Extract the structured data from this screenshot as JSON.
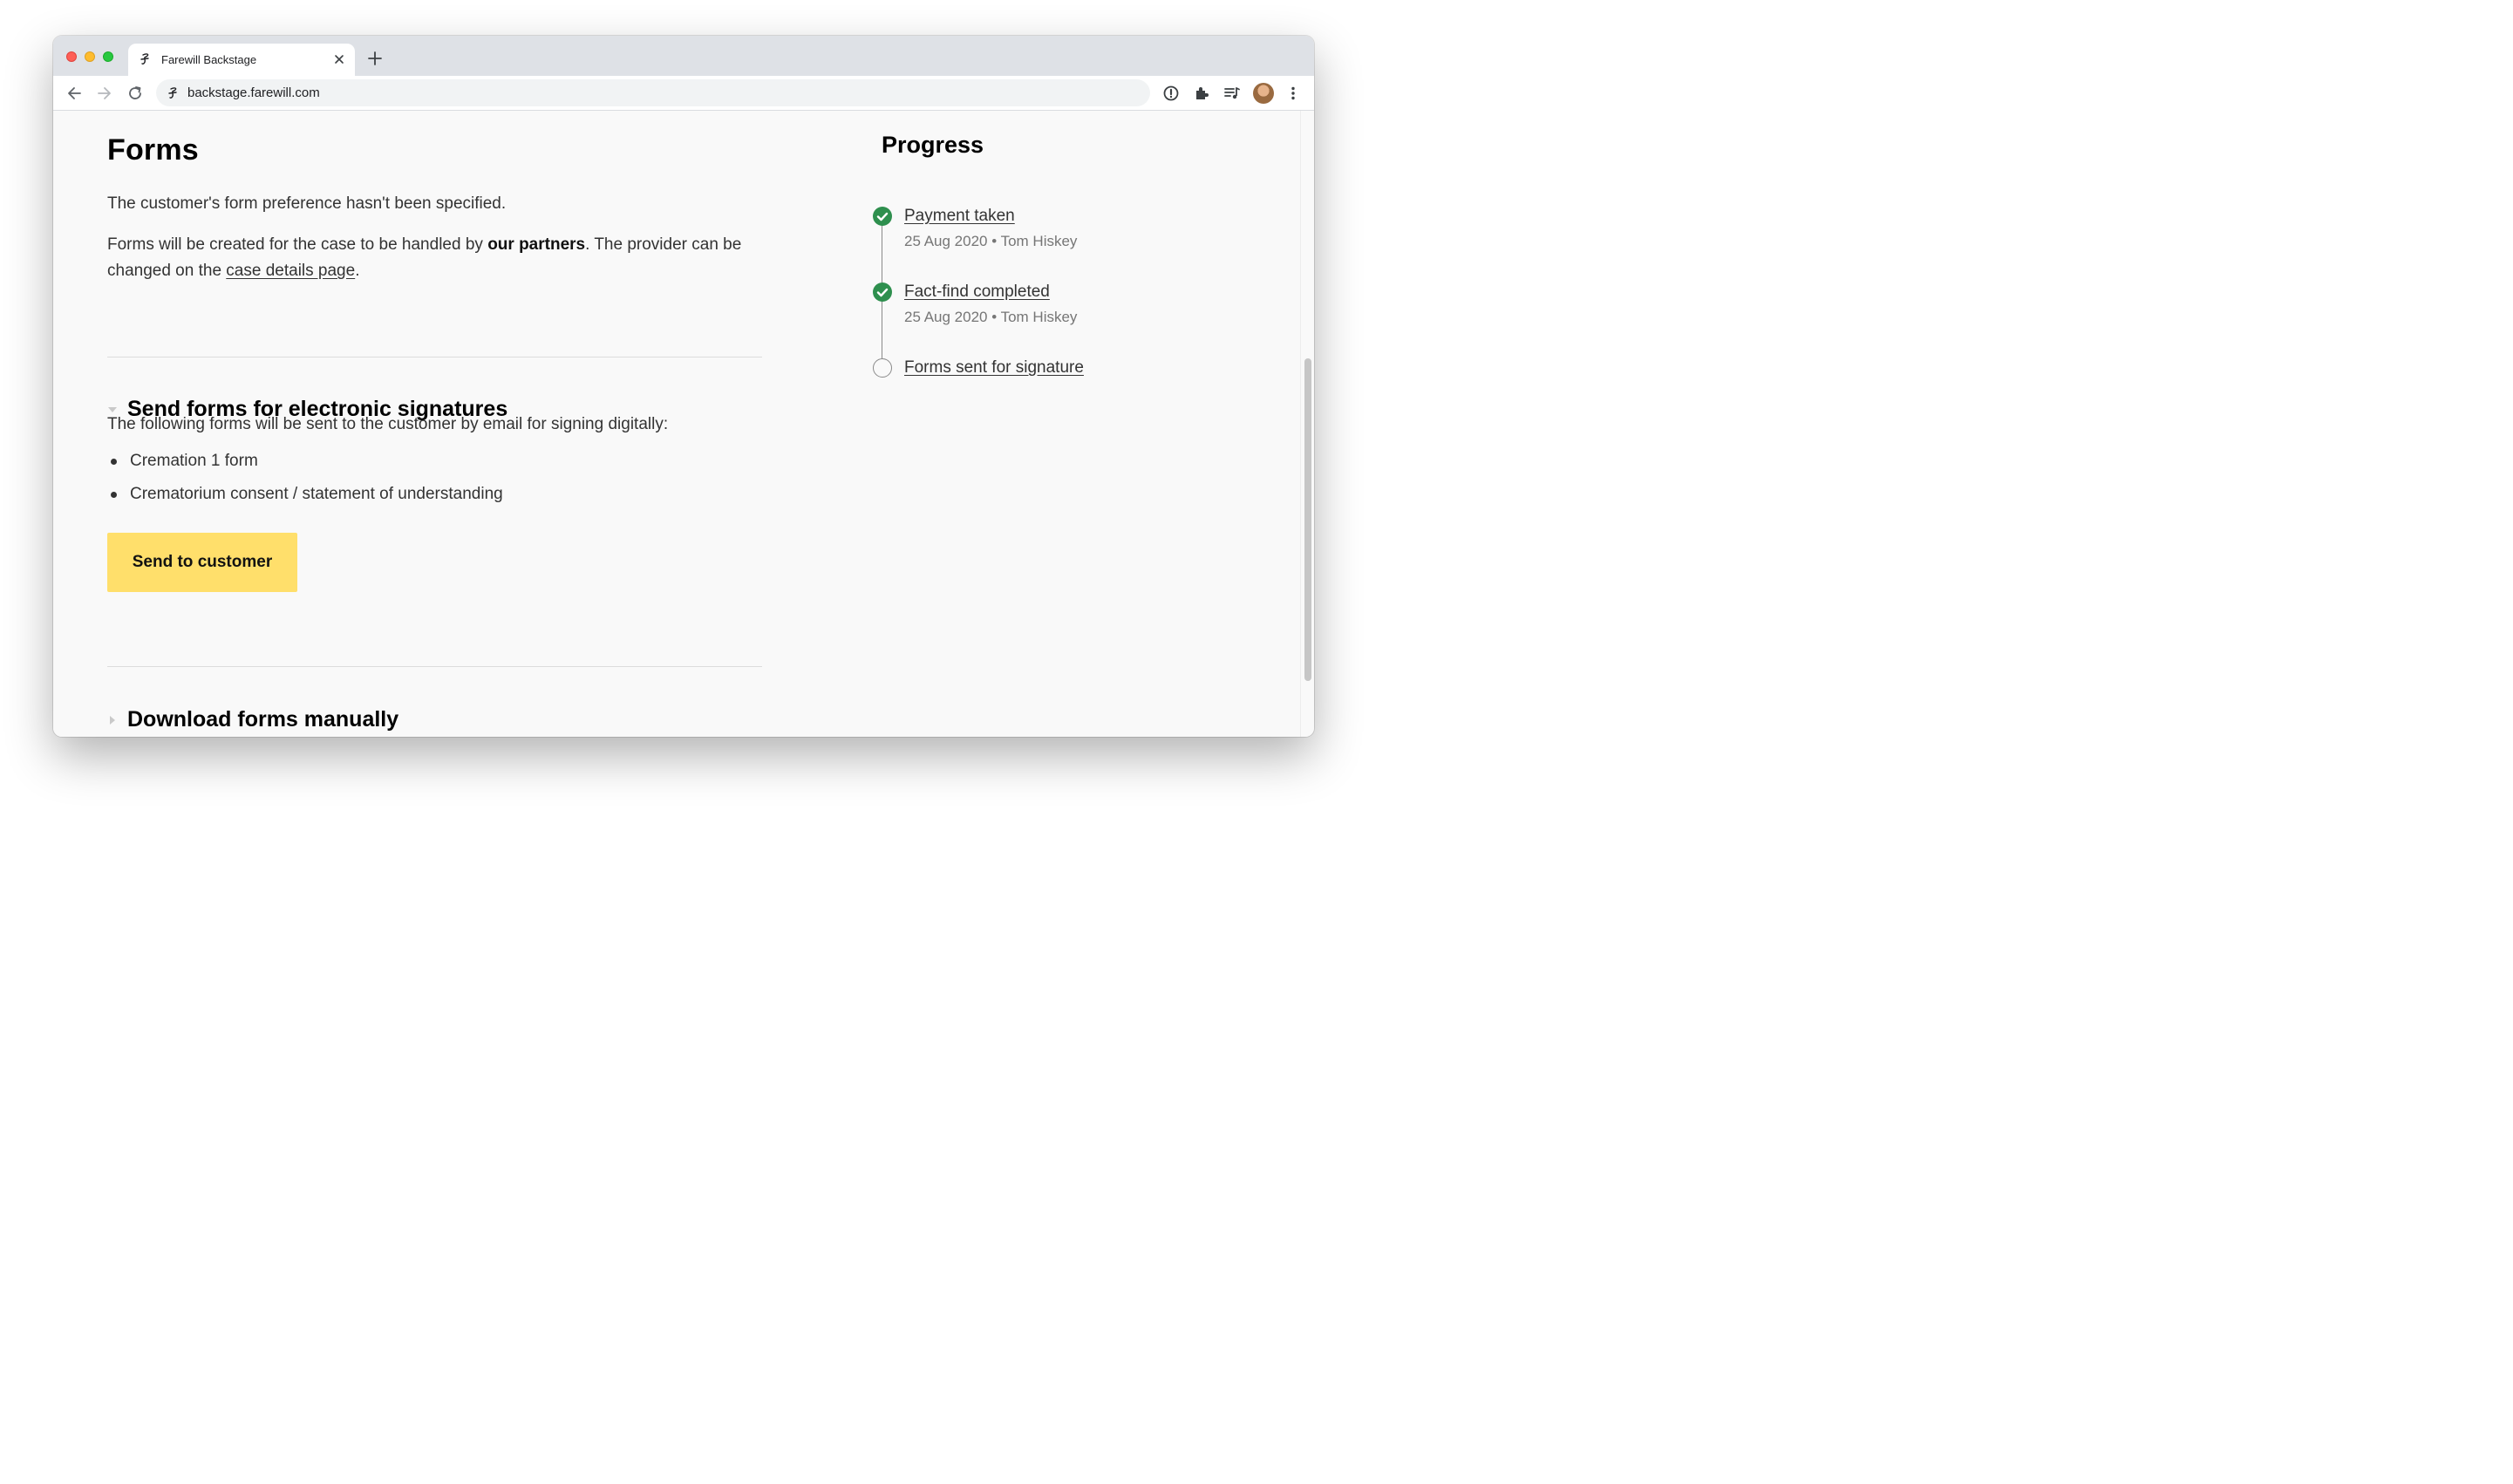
{
  "browser": {
    "tab_title": "Farewill Backstage",
    "url": "backstage.farewill.com"
  },
  "forms": {
    "title": "Forms",
    "preference_text": "The customer's form preference hasn't been specified.",
    "provider_text_1": "Forms will be created for the case to be handled by ",
    "provider_bold": "our partners",
    "provider_text_2": ". The provider can be changed on the ",
    "provider_link": "case details page",
    "provider_text_3": "."
  },
  "electronic": {
    "title": "Send forms for electronic signatures",
    "intro": "The following forms will be sent to the customer by email for signing digitally:",
    "forms_list": [
      "Cremation 1 form",
      "Crematorium consent / statement of understanding"
    ],
    "button_label": "Send to customer"
  },
  "manual": {
    "title": "Download forms manually"
  },
  "progress": {
    "title": "Progress",
    "steps": [
      {
        "title": "Payment taken",
        "meta": "25 Aug 2020 • Tom Hiskey",
        "status": "done"
      },
      {
        "title": "Fact-find completed",
        "meta": "25 Aug 2020 • Tom Hiskey",
        "status": "done"
      },
      {
        "title": "Forms sent for signature",
        "meta": "",
        "status": "pending"
      }
    ]
  },
  "colors": {
    "accent_button": "#ffdf6b",
    "step_done": "#2e8f4e"
  }
}
